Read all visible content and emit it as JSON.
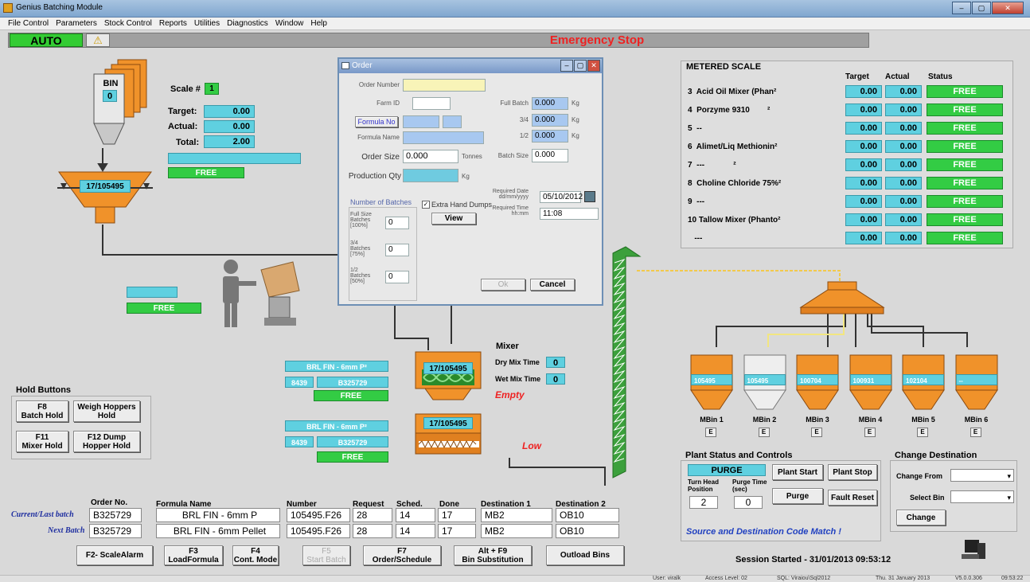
{
  "window": {
    "title": "Genius Batching Module",
    "controls": [
      "–",
      "▢",
      "✕"
    ]
  },
  "menu": [
    "File Control",
    "Parameters",
    "Stock Control",
    "Reports",
    "Utilities",
    "Diagnostics",
    "Window",
    "Help"
  ],
  "top": {
    "mode": "AUTO",
    "emergency": "Emergency Stop"
  },
  "scale": {
    "bin_label": "BIN",
    "bin_no": "0",
    "scale_label": "Scale #",
    "scale_no": "1",
    "target_label": "Target:",
    "target": "0.00",
    "actual_label": "Actual:",
    "actual": "0.00",
    "total_label": "Total:",
    "total": "2.00",
    "status": "FREE",
    "hopper_batch": "17/105495",
    "handadd_status": "FREE"
  },
  "dialog": {
    "title": "Order",
    "order_number_label": "Order Number",
    "order_number": "",
    "farm_id_label": "Farm ID",
    "farm_id": "",
    "formula_no_button": "Formula No",
    "formula_name_label": "Formula Name",
    "order_size_label": "Order Size",
    "order_size": "0.000",
    "tonnes": "Tonnes",
    "production_qty_label": "Production Qty",
    "kg": "Kg",
    "full_batch_label": "Full Batch",
    "full_batch": "0.000",
    "three_quarter_label": "3/4",
    "three_quarter": "0.000",
    "half_label": "1/2",
    "half": "0.000",
    "batch_size_label": "Batch Size",
    "batch_size": "0.000",
    "num_batches_label": "Number of Batches",
    "full_size_label": "Full Size Batches [100%]",
    "full_size": "0",
    "tq_batches_label": "3/4 Batches [75%]",
    "tq_batches": "0",
    "half_batches_label": "1/2 Batches [50%]",
    "half_batches": "0",
    "extra_hand_dumps": "Extra Hand Dumps",
    "view_button": "View",
    "req_date_label": "Required Date dd/mm/yyyy",
    "req_date": "05/10/2012",
    "req_time_label": "Required Time hh:mm",
    "req_time": "11:08",
    "ok_button": "Ok",
    "cancel_button": "Cancel"
  },
  "metered": {
    "title": "METERED SCALE",
    "headers": [
      "Target",
      "Actual",
      "Status"
    ],
    "rows": [
      {
        "name": "3  Acid Oil Mixer (Phan²",
        "target": "0.00",
        "actual": "0.00",
        "status": "FREE"
      },
      {
        "name": "4  Porzyme 9310        ²",
        "target": "0.00",
        "actual": "0.00",
        "status": "FREE"
      },
      {
        "name": "5  --",
        "target": "0.00",
        "actual": "0.00",
        "status": "FREE"
      },
      {
        "name": "6  Alimet/Liq Methionin²",
        "target": "0.00",
        "actual": "0.00",
        "status": "FREE"
      },
      {
        "name": "7  ---             ²",
        "target": "0.00",
        "actual": "0.00",
        "status": "FREE"
      },
      {
        "name": "8  Choline Chloride 75%²",
        "target": "0.00",
        "actual": "0.00",
        "status": "FREE"
      },
      {
        "name": "9  ---",
        "target": "0.00",
        "actual": "0.00",
        "status": "FREE"
      },
      {
        "name": "10 Tallow Mixer (Phanto²",
        "target": "0.00",
        "actual": "0.00",
        "status": "FREE"
      },
      {
        "name": "   ---",
        "target": "0.00",
        "actual": "0.00",
        "status": "FREE"
      }
    ]
  },
  "mixer": {
    "title": "Mixer",
    "dry_label": "Dry Mix Time",
    "dry": "0",
    "wet_label": "Wet Mix Time",
    "wet": "0",
    "batch": "17/105495",
    "state": "Empty",
    "conveyor_batch": "17/105495",
    "conveyor_state": "Low"
  },
  "queue": [
    {
      "formula": "BRL FIN - 6mm P²",
      "code": "8439",
      "order": "B325729",
      "status": "FREE"
    },
    {
      "formula": "BRL FIN - 6mm P²",
      "code": "8439",
      "order": "B325729",
      "status": "FREE"
    }
  ],
  "hold": {
    "title": "Hold Buttons",
    "buttons": [
      "F8\nBatch Hold",
      "Weigh Hoppers\nHold",
      "F11\nMixer Hold",
      "F12 Dump\nHopper Hold"
    ]
  },
  "batch_table": {
    "headers": [
      "Order No.",
      "Formula Name",
      "Number",
      "Request",
      "Sched.",
      "Done",
      "Destination 1",
      "Destination 2"
    ],
    "rows": [
      {
        "label": "Current/Last batch",
        "order": "B325729",
        "formula": "BRL FIN - 6mm P",
        "number": "105495.F26",
        "request": "28",
        "sched": "14",
        "done": "17",
        "dest1": "MB2",
        "dest2": "OB10"
      },
      {
        "label": "Next Batch",
        "order": "B325729",
        "formula": "BRL FIN - 6mm Pellet",
        "number": "105495.F26",
        "request": "28",
        "sched": "14",
        "done": "17",
        "dest1": "MB2",
        "dest2": "OB10"
      }
    ]
  },
  "fbuttons": [
    "F2- ScaleAlarm",
    "F3\nLoadFormula",
    "F4\nCont. Mode",
    "F5\nStart Batch",
    "F7\nOrder/Schedule",
    "Alt + F9\nBin Substitution",
    "Outload Bins"
  ],
  "mbins": [
    {
      "code": "105495",
      "name": "MBin 1"
    },
    {
      "code": "105495",
      "name": "MBin 2"
    },
    {
      "code": "100704",
      "name": "MBin 3"
    },
    {
      "code": "100931",
      "name": "MBin 4"
    },
    {
      "code": "102104",
      "name": "MBin 5"
    },
    {
      "code": "--",
      "name": "MBin 6"
    }
  ],
  "ebutton": "E",
  "plant": {
    "title": "Plant Status and Controls",
    "status": "PURGE",
    "turn_head_label": "Turn Head Position",
    "turn_head": "2",
    "purge_time_label": "Purge Time (sec)",
    "purge_time": "0",
    "start": "Plant Start",
    "stop": "Plant Stop",
    "purge": "Purge",
    "fault_reset": "Fault Reset",
    "match_msg": "Source and Destination Code Match !"
  },
  "dest": {
    "title": "Change Destination",
    "from_label": "Change From",
    "bin_label": "Select Bin",
    "change": "Change"
  },
  "session": "Session Started - 31/01/2013  09:53:12",
  "statusbar": [
    "User: viralk",
    "Access Level: 02",
    "SQL: Viraiou\\Sql2012",
    "Thu. 31 January 2013",
    "V5.0.0.306",
    "09:53:22"
  ],
  "colors": {
    "cyan": "#5fd0e0",
    "green": "#33cc44",
    "orange": "#f0922a",
    "red": "#ee2222"
  }
}
